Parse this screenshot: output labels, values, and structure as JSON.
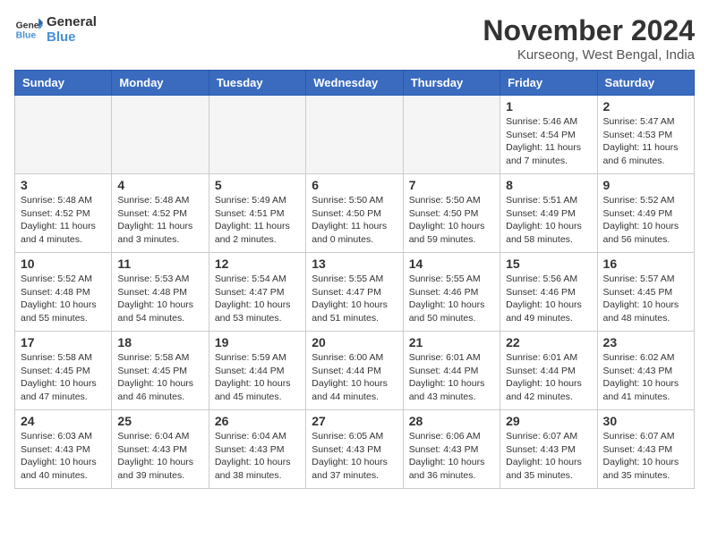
{
  "header": {
    "logo_general": "General",
    "logo_blue": "Blue",
    "month_title": "November 2024",
    "location": "Kurseong, West Bengal, India"
  },
  "weekdays": [
    "Sunday",
    "Monday",
    "Tuesday",
    "Wednesday",
    "Thursday",
    "Friday",
    "Saturday"
  ],
  "weeks": [
    [
      {
        "day": "",
        "info": ""
      },
      {
        "day": "",
        "info": ""
      },
      {
        "day": "",
        "info": ""
      },
      {
        "day": "",
        "info": ""
      },
      {
        "day": "",
        "info": ""
      },
      {
        "day": "1",
        "info": "Sunrise: 5:46 AM\nSunset: 4:54 PM\nDaylight: 11 hours\nand 7 minutes."
      },
      {
        "day": "2",
        "info": "Sunrise: 5:47 AM\nSunset: 4:53 PM\nDaylight: 11 hours\nand 6 minutes."
      }
    ],
    [
      {
        "day": "3",
        "info": "Sunrise: 5:48 AM\nSunset: 4:52 PM\nDaylight: 11 hours\nand 4 minutes."
      },
      {
        "day": "4",
        "info": "Sunrise: 5:48 AM\nSunset: 4:52 PM\nDaylight: 11 hours\nand 3 minutes."
      },
      {
        "day": "5",
        "info": "Sunrise: 5:49 AM\nSunset: 4:51 PM\nDaylight: 11 hours\nand 2 minutes."
      },
      {
        "day": "6",
        "info": "Sunrise: 5:50 AM\nSunset: 4:50 PM\nDaylight: 11 hours\nand 0 minutes."
      },
      {
        "day": "7",
        "info": "Sunrise: 5:50 AM\nSunset: 4:50 PM\nDaylight: 10 hours\nand 59 minutes."
      },
      {
        "day": "8",
        "info": "Sunrise: 5:51 AM\nSunset: 4:49 PM\nDaylight: 10 hours\nand 58 minutes."
      },
      {
        "day": "9",
        "info": "Sunrise: 5:52 AM\nSunset: 4:49 PM\nDaylight: 10 hours\nand 56 minutes."
      }
    ],
    [
      {
        "day": "10",
        "info": "Sunrise: 5:52 AM\nSunset: 4:48 PM\nDaylight: 10 hours\nand 55 minutes."
      },
      {
        "day": "11",
        "info": "Sunrise: 5:53 AM\nSunset: 4:48 PM\nDaylight: 10 hours\nand 54 minutes."
      },
      {
        "day": "12",
        "info": "Sunrise: 5:54 AM\nSunset: 4:47 PM\nDaylight: 10 hours\nand 53 minutes."
      },
      {
        "day": "13",
        "info": "Sunrise: 5:55 AM\nSunset: 4:47 PM\nDaylight: 10 hours\nand 51 minutes."
      },
      {
        "day": "14",
        "info": "Sunrise: 5:55 AM\nSunset: 4:46 PM\nDaylight: 10 hours\nand 50 minutes."
      },
      {
        "day": "15",
        "info": "Sunrise: 5:56 AM\nSunset: 4:46 PM\nDaylight: 10 hours\nand 49 minutes."
      },
      {
        "day": "16",
        "info": "Sunrise: 5:57 AM\nSunset: 4:45 PM\nDaylight: 10 hours\nand 48 minutes."
      }
    ],
    [
      {
        "day": "17",
        "info": "Sunrise: 5:58 AM\nSunset: 4:45 PM\nDaylight: 10 hours\nand 47 minutes."
      },
      {
        "day": "18",
        "info": "Sunrise: 5:58 AM\nSunset: 4:45 PM\nDaylight: 10 hours\nand 46 minutes."
      },
      {
        "day": "19",
        "info": "Sunrise: 5:59 AM\nSunset: 4:44 PM\nDaylight: 10 hours\nand 45 minutes."
      },
      {
        "day": "20",
        "info": "Sunrise: 6:00 AM\nSunset: 4:44 PM\nDaylight: 10 hours\nand 44 minutes."
      },
      {
        "day": "21",
        "info": "Sunrise: 6:01 AM\nSunset: 4:44 PM\nDaylight: 10 hours\nand 43 minutes."
      },
      {
        "day": "22",
        "info": "Sunrise: 6:01 AM\nSunset: 4:44 PM\nDaylight: 10 hours\nand 42 minutes."
      },
      {
        "day": "23",
        "info": "Sunrise: 6:02 AM\nSunset: 4:43 PM\nDaylight: 10 hours\nand 41 minutes."
      }
    ],
    [
      {
        "day": "24",
        "info": "Sunrise: 6:03 AM\nSunset: 4:43 PM\nDaylight: 10 hours\nand 40 minutes."
      },
      {
        "day": "25",
        "info": "Sunrise: 6:04 AM\nSunset: 4:43 PM\nDaylight: 10 hours\nand 39 minutes."
      },
      {
        "day": "26",
        "info": "Sunrise: 6:04 AM\nSunset: 4:43 PM\nDaylight: 10 hours\nand 38 minutes."
      },
      {
        "day": "27",
        "info": "Sunrise: 6:05 AM\nSunset: 4:43 PM\nDaylight: 10 hours\nand 37 minutes."
      },
      {
        "day": "28",
        "info": "Sunrise: 6:06 AM\nSunset: 4:43 PM\nDaylight: 10 hours\nand 36 minutes."
      },
      {
        "day": "29",
        "info": "Sunrise: 6:07 AM\nSunset: 4:43 PM\nDaylight: 10 hours\nand 35 minutes."
      },
      {
        "day": "30",
        "info": "Sunrise: 6:07 AM\nSunset: 4:43 PM\nDaylight: 10 hours\nand 35 minutes."
      }
    ]
  ]
}
